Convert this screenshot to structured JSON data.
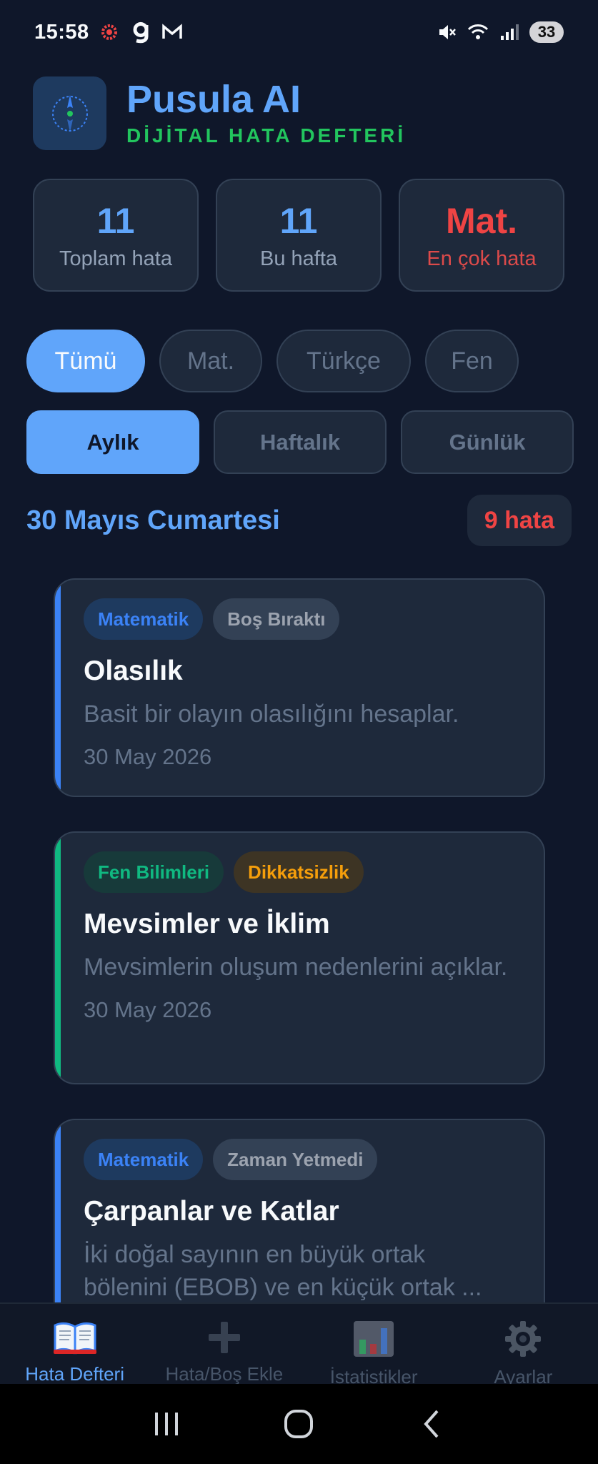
{
  "status_bar": {
    "time": "15:58",
    "battery": "33"
  },
  "app": {
    "title": "Pusula AI",
    "subtitle": "DİJİTAL HATA DEFTERİ"
  },
  "stats": [
    {
      "value": "11",
      "label": "Toplam hata"
    },
    {
      "value": "11",
      "label": "Bu hafta"
    },
    {
      "value": "Mat.",
      "label": "En çok hata"
    }
  ],
  "subject_filters": [
    {
      "label": "Tümü",
      "active": true
    },
    {
      "label": "Mat.",
      "active": false
    },
    {
      "label": "Türkçe",
      "active": false
    },
    {
      "label": "Fen",
      "active": false
    }
  ],
  "period_tabs": [
    {
      "label": "Aylık",
      "active": true
    },
    {
      "label": "Haftalık",
      "active": false
    },
    {
      "label": "Günlük",
      "active": false
    }
  ],
  "section": {
    "date_title": "30 Mayıs Cumartesi",
    "count": "9 hata"
  },
  "cards": [
    {
      "subject": "Matematik",
      "reason": "Boş Bıraktı",
      "title": "Olasılık",
      "description": "Basit bir olayın olasılığını hesaplar.",
      "date": "30 May 2026",
      "accent": "#3b82f6"
    },
    {
      "subject": "Fen Bilimleri",
      "reason": "Dikkatsizlik",
      "title": "Mevsimler ve İklim",
      "description": "Mevsimlerin oluşum nedenlerini açıklar.",
      "date": "30 May 2026",
      "accent": "#10b981"
    },
    {
      "subject": "Matematik",
      "reason": "Zaman Yetmedi",
      "title": "Çarpanlar ve Katlar",
      "description": "İki doğal sayının en büyük ortak bölenini (EBOB) ve en küçük ortak ...",
      "accent": "#3b82f6"
    }
  ],
  "bottom_nav": [
    {
      "label": "Hata Defteri",
      "icon": "book-icon",
      "active": true
    },
    {
      "label": "Hata/Boş Ekle",
      "icon": "plus-icon",
      "active": false
    },
    {
      "label": "İstatistikler",
      "icon": "bar-chart-icon",
      "active": false
    },
    {
      "label": "Ayarlar",
      "icon": "gear-icon",
      "active": false
    }
  ],
  "colors": {
    "background": "#0f172a",
    "accent_blue": "#60a5fa",
    "accent_green": "#22c55e",
    "error_red": "#ef4444",
    "card_bg": "#1e293b"
  }
}
